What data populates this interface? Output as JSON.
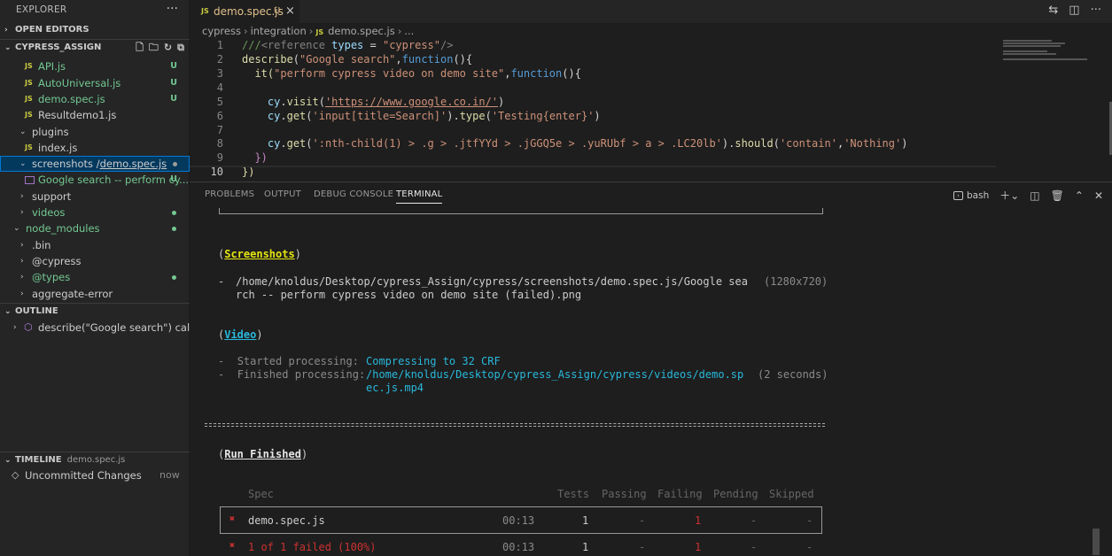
{
  "sidebar": {
    "title": "EXPLORER",
    "more": "···",
    "open_editors": "OPEN EDITORS",
    "project": "CYPRESS_ASSIGN",
    "files": [
      {
        "label": "API.js",
        "badge": "U"
      },
      {
        "label": "AutoUniversal.js",
        "badge": "U"
      },
      {
        "label": "demo.spec.js",
        "badge": "U"
      },
      {
        "label": "Resultdemo1.js",
        "badge": ""
      },
      {
        "label": "plugins",
        "badge": ""
      },
      {
        "label": "index.js",
        "badge": ""
      },
      {
        "label": "screenshots",
        "label2": "/",
        "label3": "demo.spec.js",
        "badge": ""
      },
      {
        "label": "Google search -- perform cy...",
        "badge": "U"
      },
      {
        "label": "support",
        "badge": ""
      },
      {
        "label": "videos",
        "badge": ""
      },
      {
        "label": "node_modules",
        "badge": ""
      },
      {
        "label": ".bin",
        "badge": ""
      },
      {
        "label": "@cypress",
        "badge": ""
      },
      {
        "label": "@types",
        "badge": ""
      },
      {
        "label": "aggregate-error",
        "badge": ""
      }
    ],
    "outline": "OUTLINE",
    "outline_item": "describe(\"Google search\") callback",
    "timeline": "TIMELINE",
    "timeline_file": "demo.spec.js",
    "timeline_item": "Uncommitted Changes",
    "timeline_time": "now"
  },
  "editor": {
    "tab_name": "demo.spec.js",
    "tab_status": "U",
    "breadcrumb": [
      "cypress",
      "integration",
      "demo.spec.js",
      "..."
    ],
    "line_numbers": [
      "1",
      "2",
      "3",
      "4",
      "5",
      "6",
      "7",
      "8",
      "9",
      "10"
    ],
    "lines": {
      "l1a": "///",
      "l1b": "<reference",
      "l1c": " types",
      "l1d": " = ",
      "l1e": "\"cypress\"",
      "l1f": "/>",
      "l2a": "describe",
      "l2b": "(",
      "l2c": "\"Google search\"",
      "l2d": ",",
      "l2e": "function",
      "l2f": "(){",
      "l3a": "  it(",
      "l3b": "\"perform cypress video on demo site\"",
      "l3c": ",",
      "l3d": "function",
      "l3e": "(){",
      "l5a": "    cy",
      "l5b": ".",
      "l5c": "visit",
      "l5d": "(",
      "l5e": "'https://www.google.co.in/'",
      "l5f": ")",
      "l6a": "    cy",
      "l6b": ".",
      "l6c": "get",
      "l6d": "(",
      "l6e": "'input[title=Search]'",
      "l6f": ").",
      "l6g": "type",
      "l6h": "(",
      "l6i": "'Testing{enter}'",
      "l6j": ")",
      "l8a": "    cy",
      "l8b": ".",
      "l8c": "get",
      "l8d": "(",
      "l8e": "':nth-child(1) > .g > .jtfYYd > .jGGQ5e > .yuRUbf > a > .LC20lb'",
      "l8f": ").",
      "l8g": "should",
      "l8h": "(",
      "l8i": "'contain'",
      "l8j": ",",
      "l8k": "'Nothing'",
      "l8l": ")",
      "l9": "  })",
      "l10": "})"
    }
  },
  "panel": {
    "tabs": [
      "PROBLEMS",
      "OUTPUT",
      "DEBUG CONSOLE",
      "TERMINAL"
    ],
    "shell": "bash",
    "terminal": {
      "screenshots_head": "Screenshots",
      "shot_dash": "-",
      "shot_path1": "/home/knoldus/Desktop/cypress_Assign/cypress/screenshots/demo.spec.js/Google sea",
      "shot_path2": "rch -- perform cypress video on demo site (failed).png",
      "shot_size": "(1280x720)",
      "video_head": "Video",
      "started_label": "Started processing:",
      "started_value": "Compressing to 32 CRF",
      "finished_label": "Finished processing:",
      "finished_value1": "/home/knoldus/Desktop/cypress_Assign/cypress/videos/demo.sp",
      "finished_value2": "ec.js.mp4",
      "finished_time": "(2 seconds)",
      "run_head": "Run Finished",
      "columns": [
        "Spec",
        "Tests",
        "Passing",
        "Failing",
        "Pending",
        "Skipped"
      ],
      "row": {
        "mark": "✖",
        "spec": "demo.spec.js",
        "time": "00:13",
        "tests": "1",
        "passing": "-",
        "failing": "1",
        "pending": "-",
        "skipped": "-"
      },
      "summary": {
        "mark": "✖",
        "spec": "1 of 1 failed (100%)",
        "time": "00:13",
        "tests": "1",
        "passing": "-",
        "failing": "1",
        "pending": "-",
        "skipped": "-"
      }
    }
  }
}
